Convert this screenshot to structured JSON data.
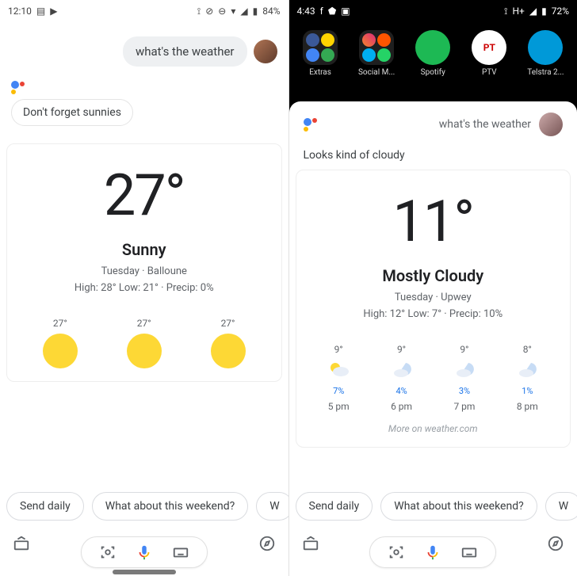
{
  "left": {
    "status": {
      "time": "12:10",
      "battery": "84%"
    },
    "user_query": "what's the weather",
    "assistant_reply": "Don't forget sunnies",
    "weather": {
      "temp": "27°",
      "condition": "Sunny",
      "day_location": "Tuesday · Balloune",
      "summary": "High: 28° Low: 21° · Precip: 0%",
      "hourly": [
        {
          "t": "27°"
        },
        {
          "t": "27°"
        },
        {
          "t": "27°"
        }
      ]
    },
    "chips": [
      "Send daily",
      "What about this weekend?",
      "W"
    ]
  },
  "right": {
    "status": {
      "time": "4:43",
      "net": "H+",
      "battery": "72%"
    },
    "apps": [
      {
        "label": "Extras"
      },
      {
        "label": "Social M..."
      },
      {
        "label": "Spotify"
      },
      {
        "label": "PTV"
      },
      {
        "label": "Telstra 2..."
      }
    ],
    "user_query": "what's the weather",
    "assistant_reply": "Looks kind of cloudy",
    "weather": {
      "temp": "11°",
      "condition": "Mostly Cloudy",
      "day_location": "Tuesday · Upwey",
      "summary": "High: 12° Low: 7° · Precip: 10%",
      "hourly": [
        {
          "t": "9°",
          "p": "7%",
          "h": "5 pm"
        },
        {
          "t": "9°",
          "p": "4%",
          "h": "6 pm"
        },
        {
          "t": "9°",
          "p": "3%",
          "h": "7 pm"
        },
        {
          "t": "8°",
          "p": "1%",
          "h": "8 pm"
        }
      ],
      "more": "More on weather.com"
    },
    "chips": [
      "Send daily",
      "What about this weekend?",
      "W"
    ]
  }
}
